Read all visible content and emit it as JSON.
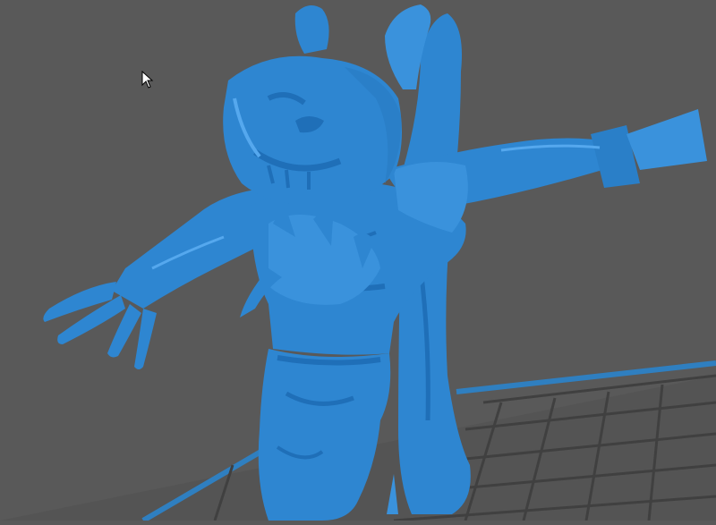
{
  "viewport": {
    "background": "#595959",
    "grid": {
      "line_color": "#3f3f3f",
      "edge_color": "#2f7fc0"
    },
    "model": {
      "color": "#2e86d1",
      "shade_color": "#1f6fb8",
      "highlight_color": "#55a8ee",
      "description_icon": "scarecrow-model-icon"
    }
  },
  "cursor": {
    "icon": "arrow-cursor-icon"
  }
}
